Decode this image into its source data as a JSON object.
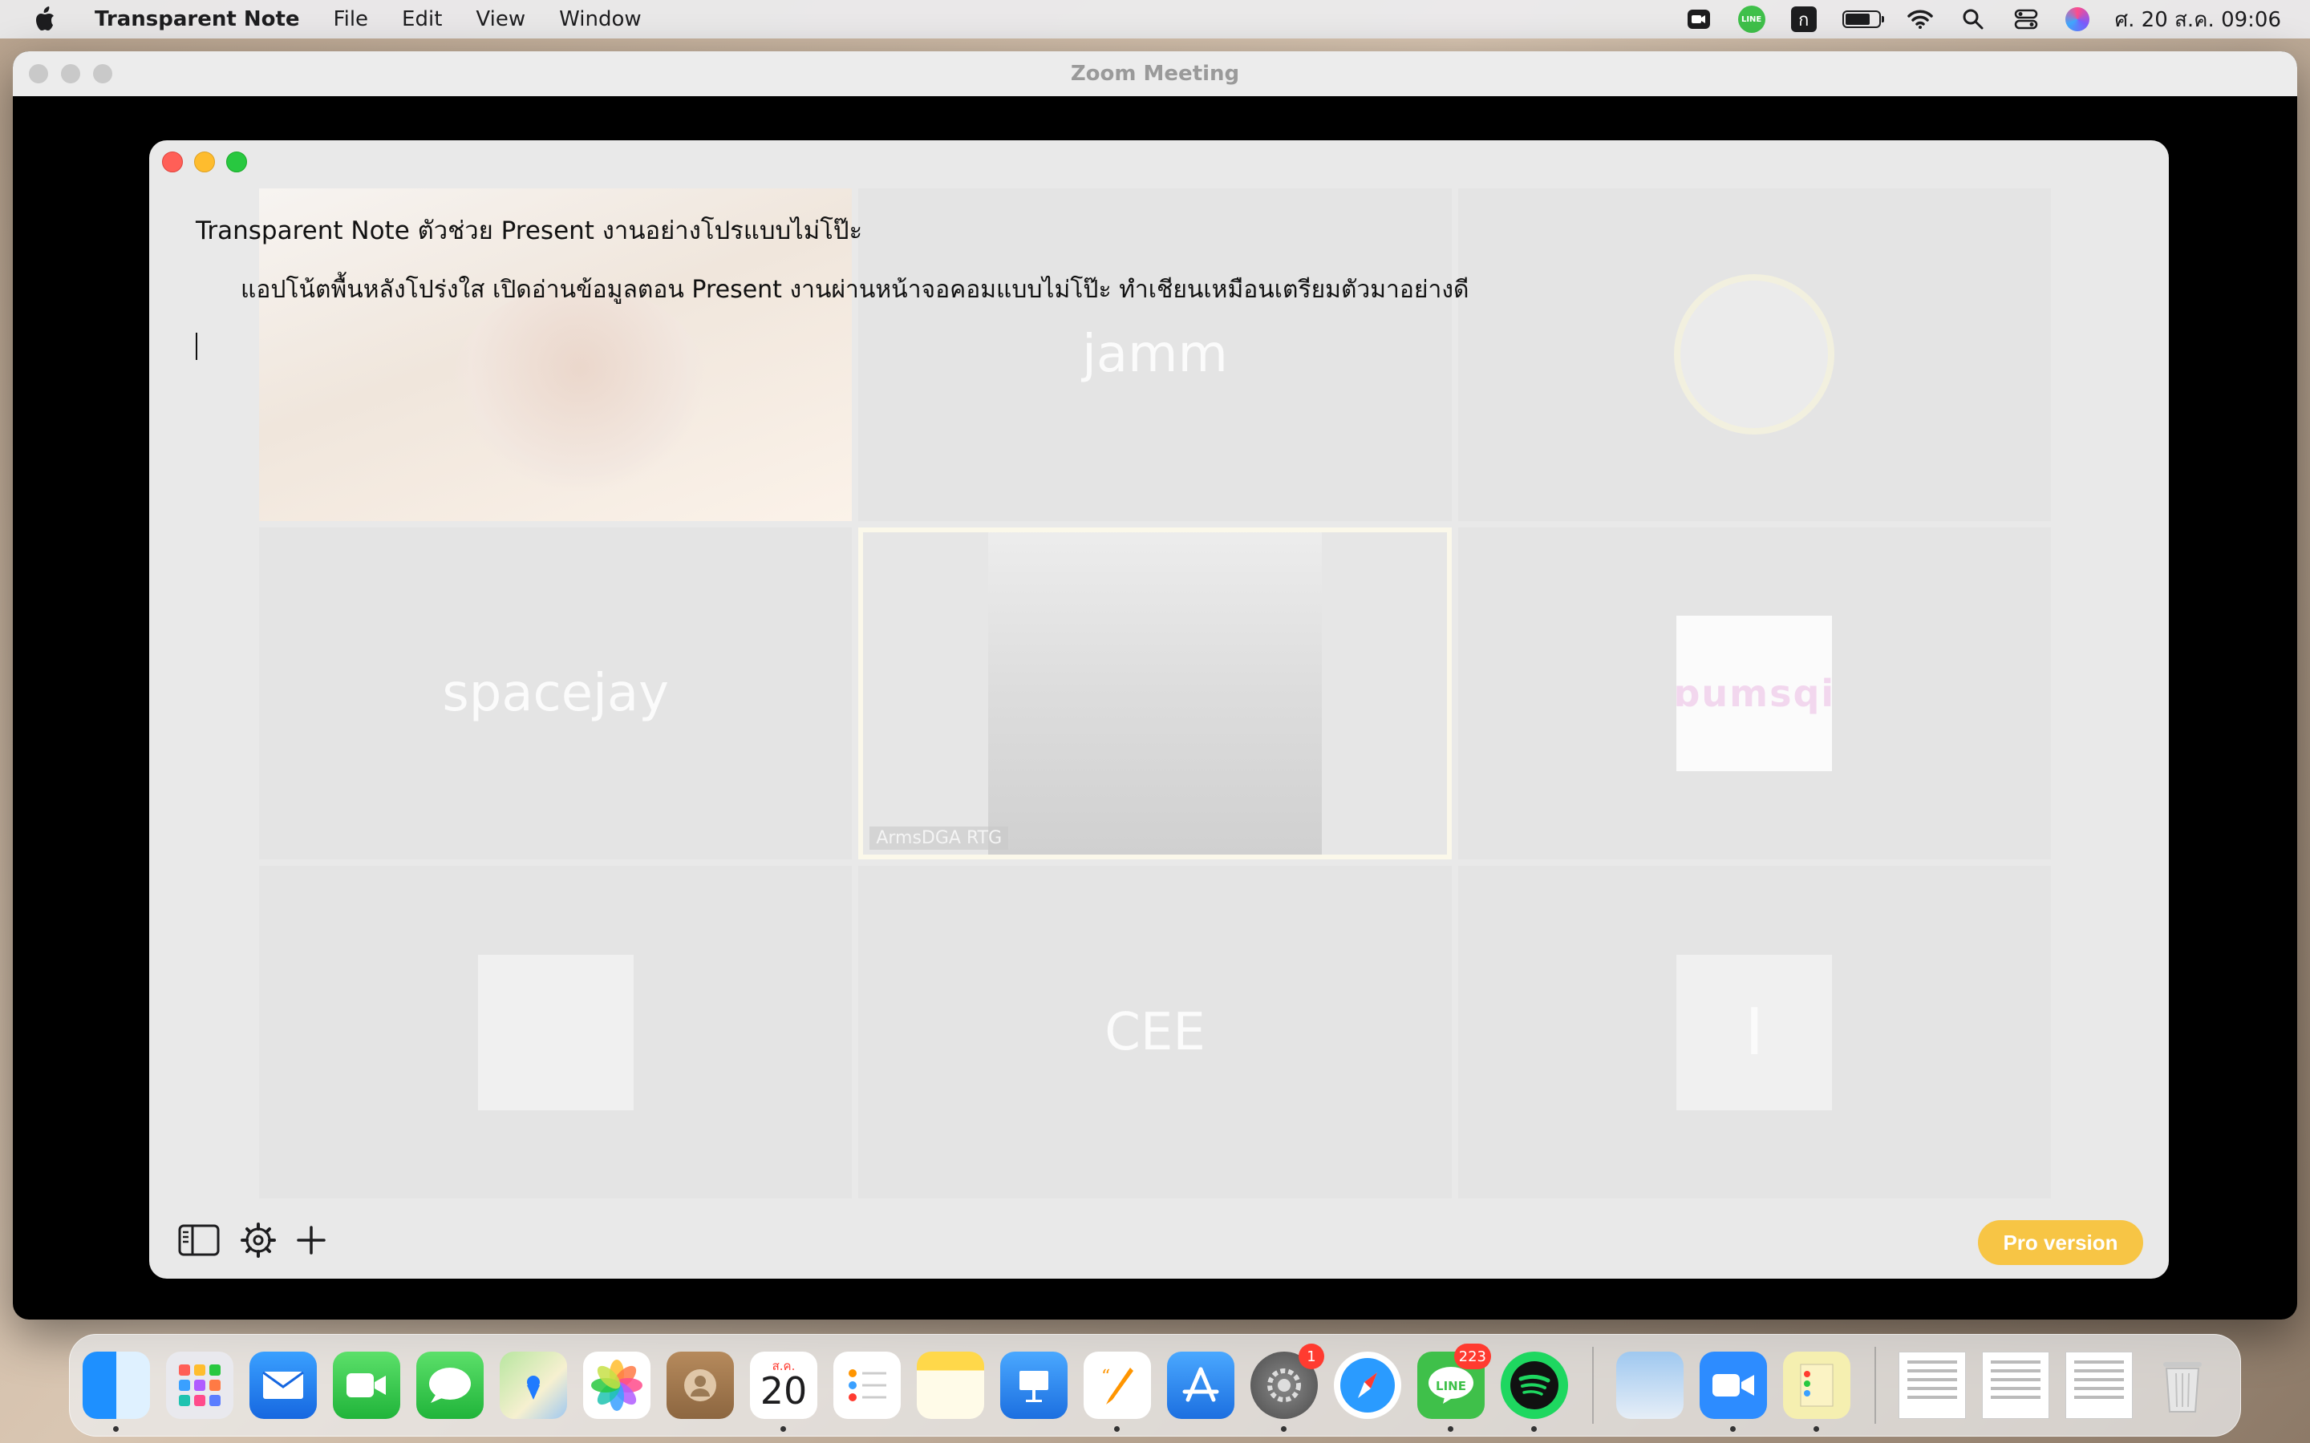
{
  "menubar": {
    "app_name": "Transparent Note",
    "menus": [
      "File",
      "Edit",
      "View",
      "Window"
    ],
    "status_icons": [
      "video-camera-icon",
      "line-icon",
      "keyboard-input-icon",
      "battery-icon",
      "wifi-icon",
      "spotlight-search-icon",
      "control-center-icon",
      "siri-icon"
    ],
    "line_text": "LINE",
    "input_source": "ก",
    "clock": "ศ. 20 ส.ค.  09:06"
  },
  "zoom": {
    "title": "Zoom Meeting",
    "tiles": [
      {
        "kind": "video"
      },
      {
        "kind": "name",
        "name": "jamm"
      },
      {
        "kind": "avatar-circle"
      },
      {
        "kind": "name",
        "name": "spacejay"
      },
      {
        "kind": "video-active",
        "name": "ArmsDGA RTG"
      },
      {
        "kind": "avatar-logo",
        "logo_text": "ɒumsqi"
      },
      {
        "kind": "avatar-photo"
      },
      {
        "kind": "name",
        "name": "CEE"
      },
      {
        "kind": "avatar-letter",
        "letter": "I"
      }
    ]
  },
  "note": {
    "heading": "Transparent Note ตัวช่วย Present งานอย่างโปรแบบไม่โป๊ะ",
    "body": "แอปโน้ตพื้นหลังโปร่งใส เปิดอ่านข้อมูลตอน Present งานผ่านหน้าจอคอมแบบไม่โป๊ะ ทำเชียนเหมือนเตรียมตัวมาอย่างดี",
    "toolbar": {
      "sidebar_icon": "sidebar-icon",
      "settings_icon": "gear-icon",
      "add_icon": "plus-icon",
      "pro_label": "Pro version",
      "pro_color": "#f7c545"
    }
  },
  "dock": {
    "apps": [
      "Finder",
      "Launchpad",
      "Mail",
      "FaceTime",
      "Messages",
      "Maps",
      "Photos",
      "Contacts",
      "Calendar",
      "Reminders",
      "Notes",
      "Keynote",
      "Pages",
      "App Store",
      "System Preferences",
      "Safari",
      "LINE",
      "Spotify",
      "Preview",
      "Zoom",
      "Stickies",
      "Document 1",
      "Document 2",
      "Document 3",
      "Trash"
    ],
    "calendar_month": "ส.ค.",
    "calendar_day": "20",
    "system_preferences_badge": "1",
    "line_badge": "223",
    "line_text": "LINE"
  }
}
